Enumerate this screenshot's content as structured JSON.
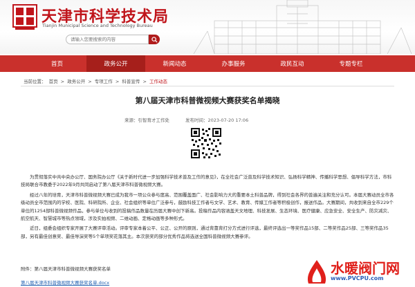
{
  "header": {
    "site_title": "天津市科学技术局",
    "site_subtitle": "Tianjin Municipal Science and Technology Bureau",
    "logo_text": "天津市科学技术局",
    "search_placeholder": "请输入您要搜索的内容"
  },
  "nav": {
    "items": [
      {
        "label": "首页"
      },
      {
        "label": "政务公开"
      },
      {
        "label": "新闻动态"
      },
      {
        "label": "办事服务"
      },
      {
        "label": "政民互动"
      },
      {
        "label": "专题专栏"
      }
    ],
    "active_index": 1
  },
  "breadcrumb": {
    "label": "当前位置：",
    "items": [
      "首页",
      "政务公开",
      "专项工作",
      "科普宣传",
      "工作动态"
    ],
    "separator": ">"
  },
  "article": {
    "title": "第八届天津市科普微视频大赛获奖名单揭晓",
    "source": "来源：引智育才工作处",
    "date": "发布时间：2023-07-20 17:06",
    "paragraphs": [
      "为贯彻落实中共中央办公厅、国务院办公厅《关于新时代进一步加强科学技术普及工作的意见》，在全社会广泛普及科学技术知识、弘扬科学精神、传播科学思想、倡导科学方法，市科技局联合市教委于2022年9月共同启动了第八届天津市科普微视频大赛。",
      "经过八年的培育，天津市科普微视频大赛已成为我市一项公众参与度高、范围覆盖面广、社会影响力大的重要本土科普品牌，得到社会各界的普遍关注和充分认可。本届大赛动员全市各级动员全市范围内的学校、医院、科研院所、企业、社会组织等单位广泛参与，鼓励科技工作者与文学、艺术、教育、传媒工作者等积极创作，报送作品。大赛期间，共收到来自全市229个单位的1254部科普微视频作品，参与单位与收到的投稿作品数量在历届大赛中创下新高。投稿作品内容涵盖天文地理、科技发展、生态环境、医疗健康、应急安全、安全生产、防灾减灾、航空航天、智慧城市等热点领域，涉及实拍视频、二维动画、定格动画等多种形式。",
      "近日，组委会组织专家开展了大赛评审活动。评审专家本着公平、公正、公开的原则，通过背靠背打分方式进行评选，最终评选出一等奖作品15部、二等奖作品25部、三等奖作品35部，另有最佳创意奖、最佳导演奖等5个单项奖花落其主。本次获奖的部分优秀作品将选送全国科普微视频大赛参评。"
    ],
    "attachment_label": "附件：第八届天津市科普微视频大赛获奖名单",
    "attachment_link": "第八届天津市科普微视频大赛获奖名单.docx"
  },
  "watermark": {
    "brand": "水暖阀门网",
    "url": "www.PVCPU.com"
  },
  "colors": {
    "nav_bg": "#c9302c",
    "nav_active": "#a61f1b",
    "title_red": "#c0151b",
    "link_blue": "#1f5fb0"
  }
}
